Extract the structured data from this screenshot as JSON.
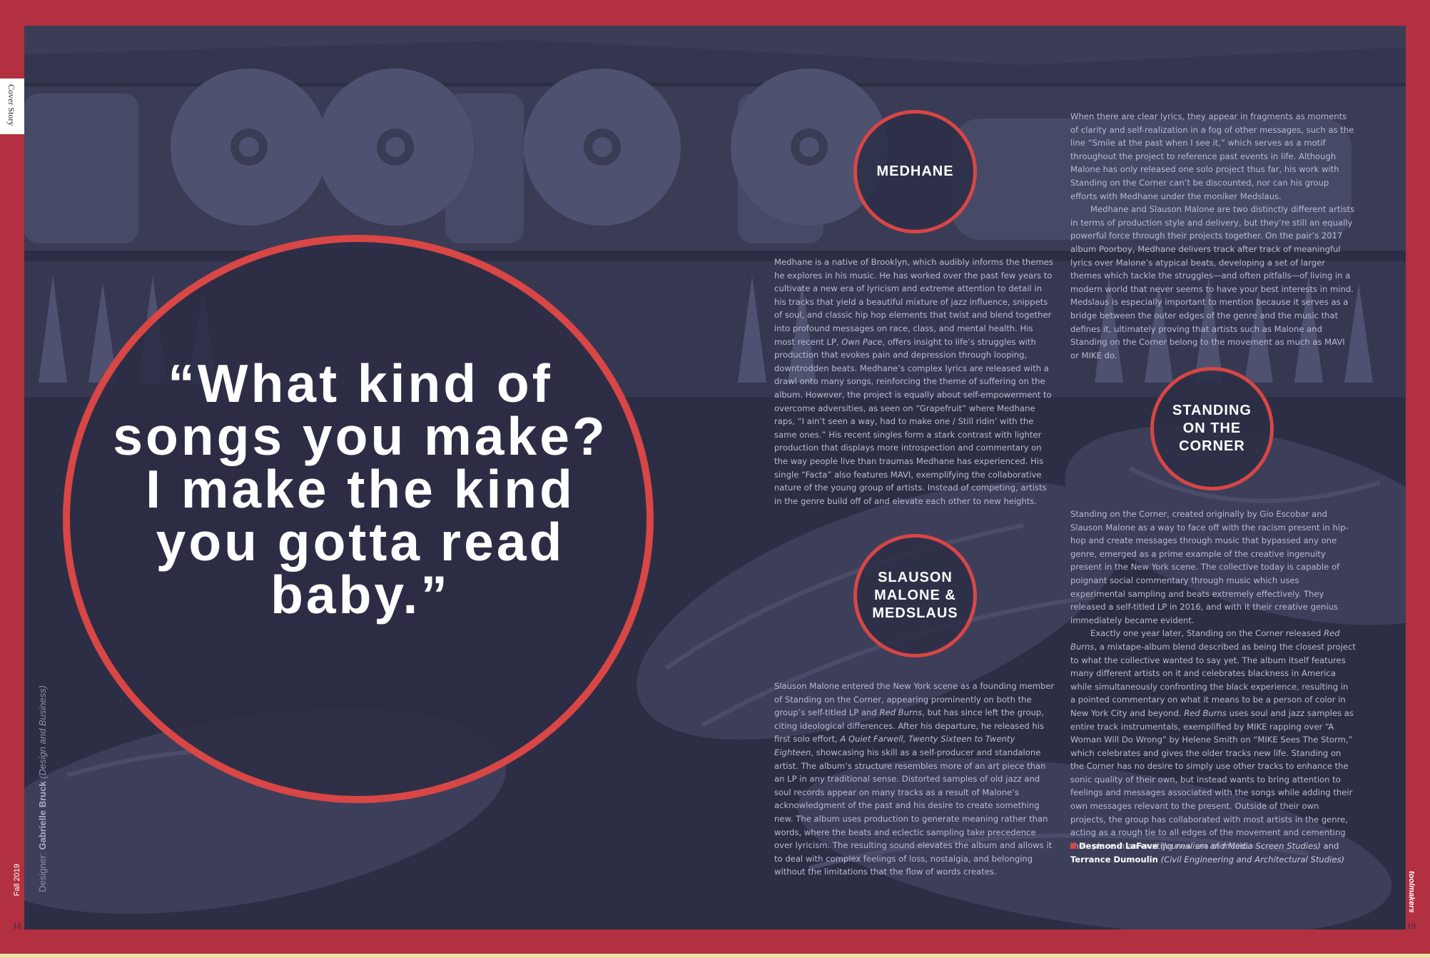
{
  "section_tab": "Cover Story",
  "footer": {
    "issue": "Fall 2019",
    "page_left": "18",
    "page_right": "19",
    "brand": "toolmakers"
  },
  "designer": {
    "prefix": "Designer: ",
    "name": "Gabrielle Bruck",
    "dept": "(Design and Business)"
  },
  "pull_quote": "“What kind of songs you make? I make the kind you gotta read baby.”",
  "badges": {
    "medhane": "MEDHANE",
    "slauson": "SLAUSON MALONE & MEDSLAUS",
    "standing": "STANDING ON THE CORNER"
  },
  "medhane": {
    "p1a": "Medhane is a native of Brooklyn, which audibly informs the themes he explores in his music. He has worked over the past few years to cultivate a new era of lyricism and extreme attention to detail in his tracks that yield a beautiful mixture of jazz influence, snippets of soul, and classic hip hop elements that twist and blend together into profound messages on race, class, and mental health. His most recent LP, ",
    "p1_italic": "Own Pace",
    "p1b": ", offers insight to life’s struggles with production that evokes pain and depression through looping, downtrodden beats. Medhane’s complex lyrics are released with a drawl onto many songs, reinforcing the theme of suffering on the album. However, the project is equally about self-empowerment to overcome adversities, as seen on “Grapefruit” where Medhane raps, “I ain’t seen a way, had to make one / Still ridin’ with the same ones.” His recent singles form a stark contrast with lighter production that displays more introspection and commentary on the way people live than traumas Medhane has experienced. His single “Facta” also features MAVI, exemplifying the collaborative nature of the young group of artists. Instead of competing, artists in the genre build off of and elevate each other to new heights."
  },
  "slauson": {
    "p1a": "Slauson Malone entered the New York scene as a founding member of Standing on the Corner, appearing prominently on both the group’s self-titled LP and ",
    "p1_italic1": "Red Burns",
    "p1b": ", but has since left the group, citing ideological differences. After his departure, he released his first solo effort, ",
    "p1_italic2": "A Quiet Farwell, Twenty Sixteen to Twenty Eighteen",
    "p1c": ", showcasing his skill as a self-producer and standalone artist. The album’s structure resembles more of an art piece than an LP in any traditional sense. Distorted samples of old jazz and soul records appear on many tracks as a result of Malone’s acknowledgment of the past and his desire to create something new. The album uses production to generate meaning rather than words, where the beats and eclectic sampling take precedence over lyricism. The resulting sound elevates the album and allows it to deal with complex feelings of loss, nostalgia, and belonging without the limitations that the flow of words creates."
  },
  "right_top": {
    "p1": "When there are clear lyrics, they appear in fragments as moments of clarity and self-realization in a fog of other messages, such as the line “Smile at the past when I see it,” which serves as a motif throughout the project to reference past events in life. Although Malone has only released one solo project thus far, his work with Standing on the Corner can’t be discounted, nor can his group efforts with Medhane under the moniker Medslaus.",
    "p2": "Medhane and Slauson Malone are two distinctly different artists in terms of production style and delivery, but they’re still an equally powerful force through their projects together. On the pair’s 2017 album Poorboy, Medhane delivers track after track of meaningful lyrics over Malone’s atypical beats, developing a set of larger themes which tackle the struggles—and often pitfalls—of living in a modern world that never seems to have your best interests in mind. Medslaus is especially important to mention because it serves as a bridge between the outer edges of the genre and the music that defines it, ultimately proving that artists such as Malone and Standing on the Corner belong to the movement as much as MAVI or MIKE do."
  },
  "standing": {
    "p1": "Standing on the Corner, created originally by Gio Escobar and Slauson Malone as a way to face off with the racism present in hip-hop and create messages through music that bypassed any one genre, emerged as a prime example of the creative ingenuity present in the New York scene. The collective today is capable of poignant social commentary through music which uses experimental sampling and beats extremely effectively. They released a self-titled LP in 2016, and with it their creative genius immediately became evident.",
    "p2a": "Exactly one year later, Standing on the Corner released ",
    "p2_italic1": "Red Burns",
    "p2b": ", a mixtape-album blend described as being the closest project to what the collective wanted to say yet. The album itself features many different artists on it and celebrates blackness in America while simultaneously confronting the black experience, resulting in a pointed commentary on what it means to be a person of color in New York City and beyond. ",
    "p2_italic2": "Red Burns",
    "p2c": " uses soul and jazz samples as entire track instrumentals, exemplified by MIKE rapping over “A Woman Will Do Wrong” by Helene Smith on “MIKE Sees The Storm,” which celebrates and gives the older tracks new life. Standing on the Corner has no desire to simply use other tracks to enhance the sonic quality of their own, but instead wants to bring attention to feelings and messages associated with the songs while adding their own messages relevant to the present. Outside of their own projects, the group has collaborated with most artists in the genre, acting as a rough tie to all edges of the movement and cementing their place in an exciting new era of music."
  },
  "credits": {
    "author1": "Desmond LaFave",
    "author1_dept": "(Journalism and Media Screen Studies)",
    "and": " and",
    "author2": "Terrance Dumoulin",
    "author2_dept": "(Civil Engineering and Architectural Studies)"
  },
  "colors": {
    "frame": "#b2303f",
    "background": "#2c2e45",
    "accent": "#d84645",
    "text": "#b8bad0"
  }
}
